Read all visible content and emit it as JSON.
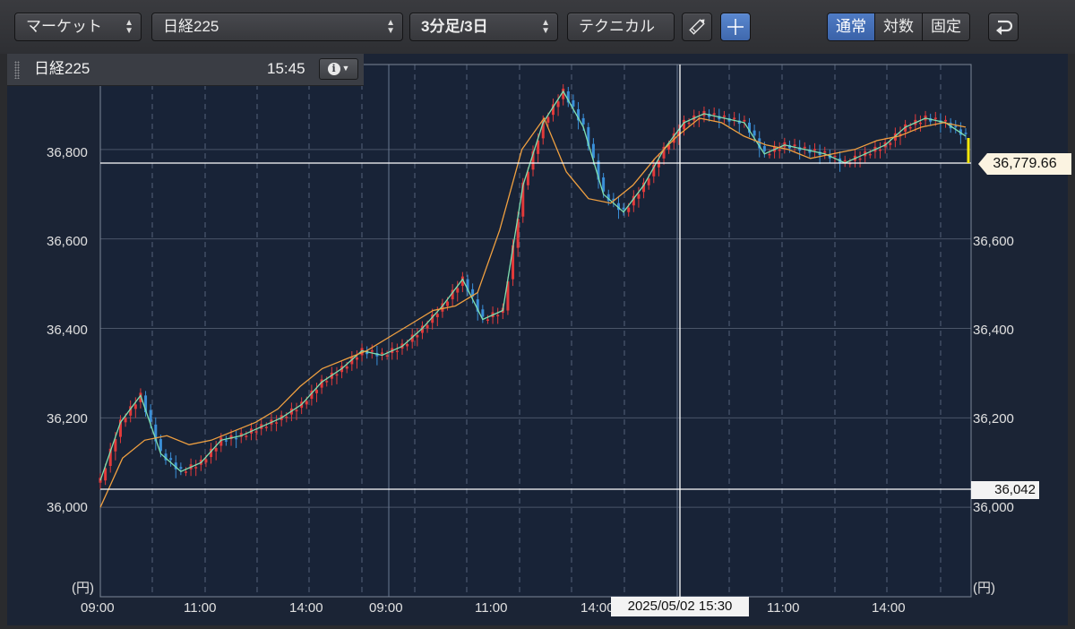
{
  "toolbar": {
    "market": "マーケット",
    "symbol": "日経225",
    "period": "3分足/3日",
    "technical": "テクニカル",
    "scale_modes": [
      "通常",
      "対数",
      "固定"
    ],
    "active_scale": "通常"
  },
  "infobox": {
    "symbol": "日経225",
    "time": "15:45"
  },
  "axis": {
    "y_left": [
      "36,800",
      "36,600",
      "36,400",
      "36,200",
      "36,000"
    ],
    "y_right": [
      "36,600",
      "36,400",
      "36,200",
      "36,000"
    ],
    "unit": "(円)",
    "x": [
      "09:00",
      "11:00",
      "14:00",
      "09:00",
      "11:00",
      "14:00",
      "11:00",
      "14:00"
    ]
  },
  "markers": {
    "current_price": "36,779.66",
    "low_line": "36,042",
    "crosshair_time": "2025/05/02 15:30"
  },
  "colors": {
    "up": "#e23a3a",
    "down": "#3a8fd8",
    "ma_short": "#7fe0b0",
    "ma_long": "#f0a040",
    "background": "#182337"
  },
  "chart_data": {
    "type": "line",
    "ylim": [
      35800,
      36990
    ],
    "series": [
      {
        "values": [
          36060,
          36190,
          36250,
          36120,
          36080,
          36100,
          36150,
          36160,
          36180,
          36200,
          36230,
          36280,
          36310,
          36350,
          36340,
          36360,
          36400,
          36450,
          36510,
          36420,
          36440,
          36720,
          36860,
          36930,
          36850,
          36700,
          36660,
          36720,
          36800,
          36860,
          36880,
          36870,
          36860,
          36790,
          36810,
          36800,
          36790,
          36770,
          36790,
          36810,
          36850,
          36870,
          36860,
          36830
        ]
      },
      {
        "values": [
          36000,
          36110,
          36150,
          36160,
          36140,
          36150,
          36170,
          36190,
          36220,
          36270,
          36310,
          36330,
          36350,
          36380,
          36410,
          36440,
          36450,
          36480,
          36620,
          36800,
          36870,
          36750,
          36690,
          36680,
          36720,
          36780,
          36830,
          36870,
          36860,
          36830,
          36810,
          36800,
          36780,
          36790,
          36800,
          36820,
          36830,
          36850,
          36860,
          36850
        ]
      }
    ]
  }
}
